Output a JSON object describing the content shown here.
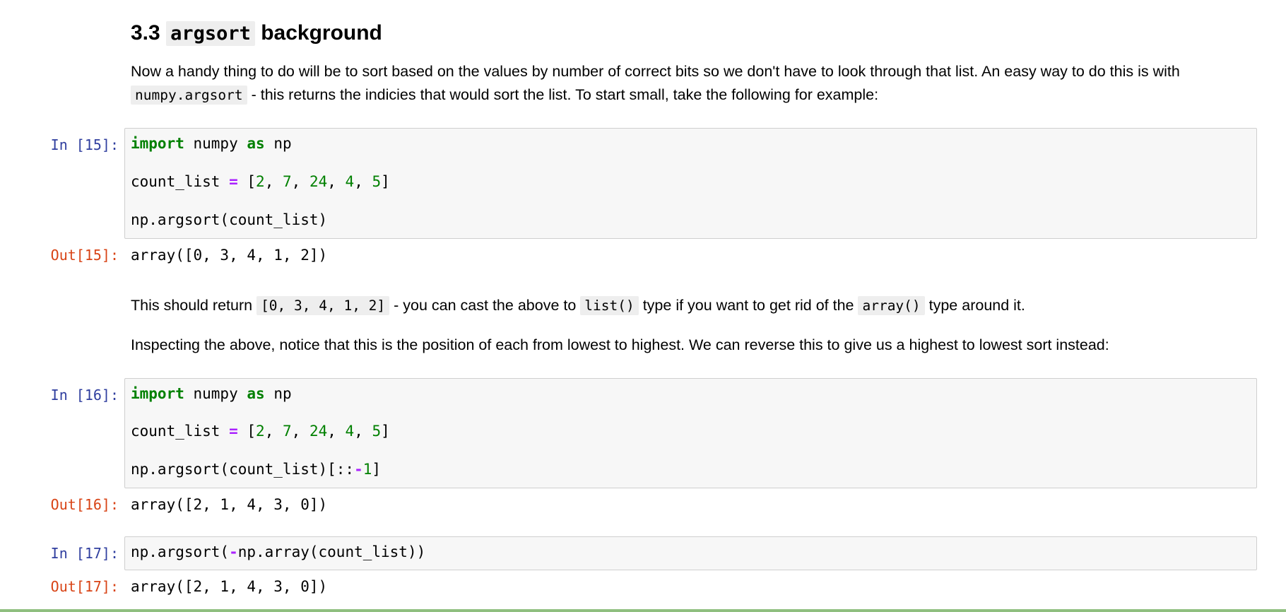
{
  "heading": {
    "number": "3.3",
    "code": "argsort",
    "word": "background"
  },
  "intro": {
    "line1": "Now a handy thing to do will be to sort based on the values by number of correct bits so we don't have to look through that list. An easy way to do this is with",
    "code": "numpy.argsort",
    "line2_rest": " - this returns the indicies that would sort the list. To start small, take the following for example:"
  },
  "cells": [
    {
      "prompt_in": "In [15]:",
      "prompt_out": "Out[15]:",
      "output": "array([0, 3, 4, 1, 2])"
    },
    {
      "prompt_in": "In [16]:",
      "prompt_out": "Out[16]:",
      "output": "array([2, 1, 4, 3, 0])"
    },
    {
      "prompt_in": "In [17]:",
      "prompt_out": "Out[17]:",
      "output": "array([2, 1, 4, 3, 0])"
    }
  ],
  "code": {
    "import_kw": "import",
    "import_mod": " numpy ",
    "as_kw": "as",
    "import_alias": " np",
    "count_name": "count_list ",
    "eq": "=",
    "list_open": " [",
    "n1": "2",
    "n2": "7",
    "n3": "24",
    "n4": "4",
    "n5": "5",
    "sep": ", ",
    "list_close": "]",
    "argsort_call": "np.argsort(count_list)",
    "argsort_rev_prefix": "np.argsort(count_list)[::",
    "minus": "-",
    "one": "1",
    "rev_close": "]",
    "neg_prefix": "np.argsort(",
    "neg_rest": "np.array(count_list))"
  },
  "para2": {
    "a": "This should return ",
    "code1": "[0, 3, 4, 1, 2]",
    "b": " - you can cast the above to ",
    "code2": "list()",
    "c": " type if you want to get rid of the ",
    "code3": "array()",
    "d": " type around it."
  },
  "para3": "Inspecting the above, notice that this is the position of each from lowest to highest. We can reverse this to give us a highest to lowest sort instead:"
}
